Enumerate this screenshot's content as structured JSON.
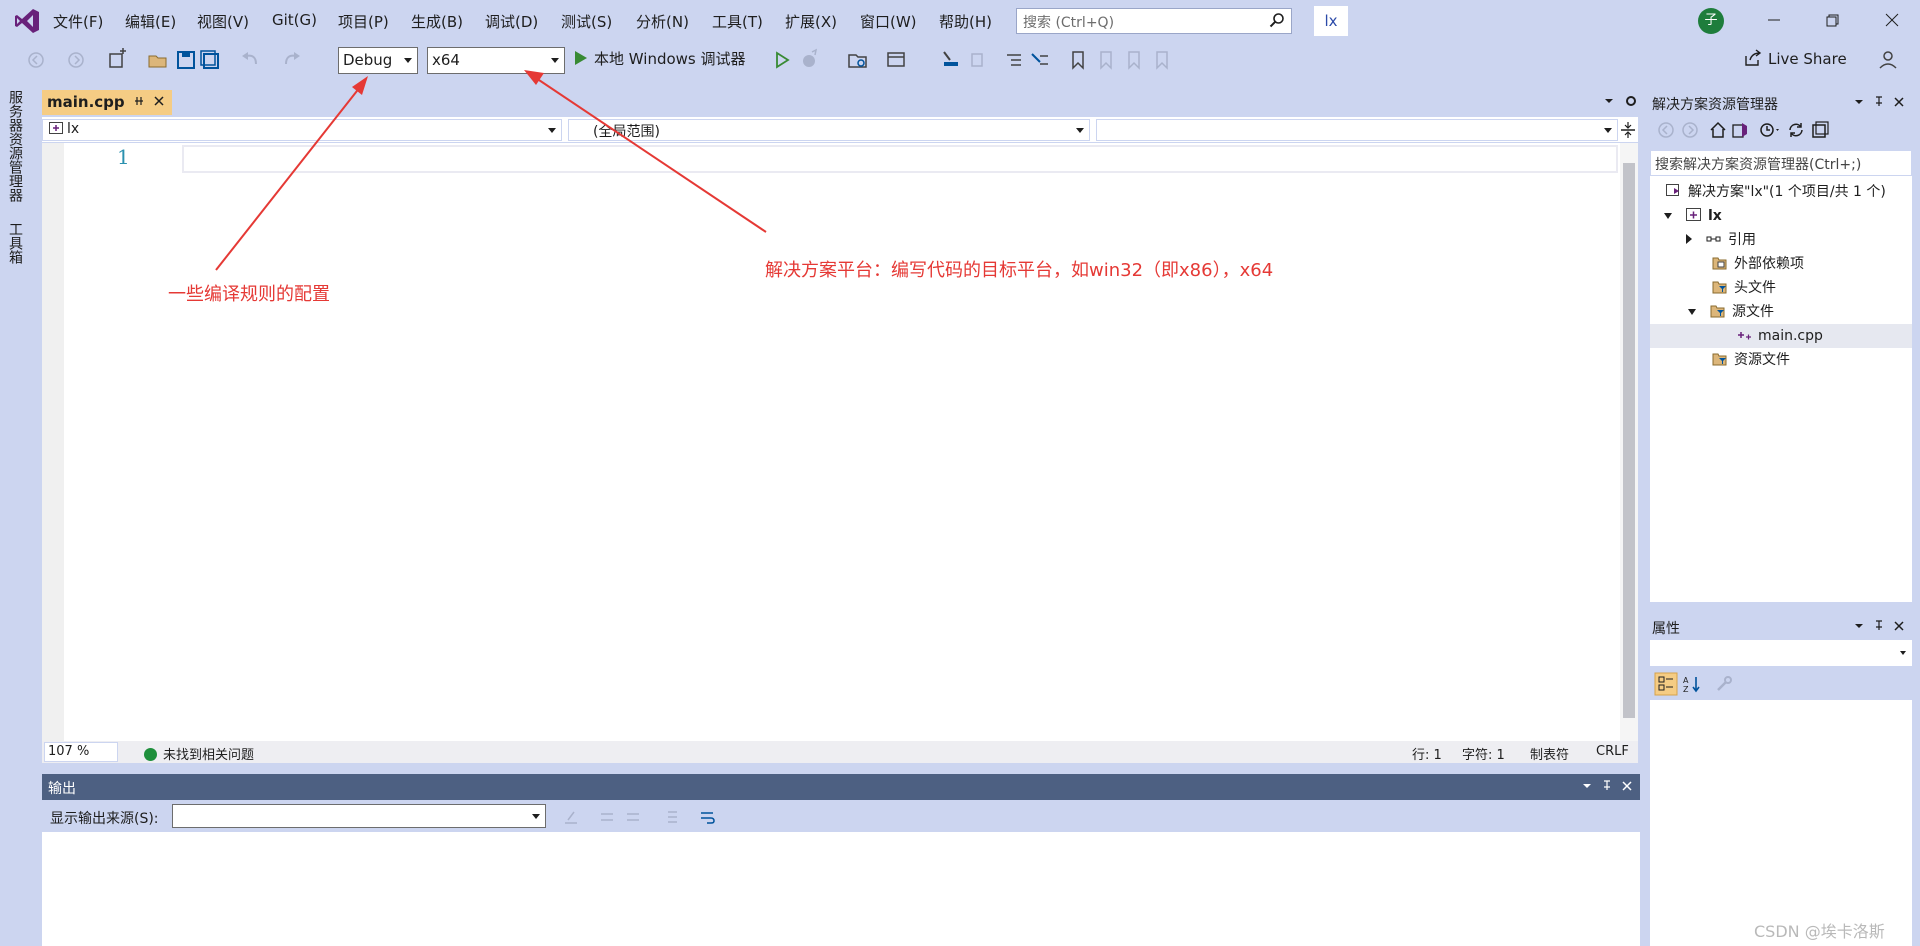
{
  "menubar": {
    "items": [
      "文件(F)",
      "编辑(E)",
      "视图(V)",
      "Git(G)",
      "项目(P)",
      "生成(B)",
      "调试(D)",
      "测试(S)",
      "分析(N)",
      "工具(T)",
      "扩展(X)",
      "窗口(W)",
      "帮助(H)"
    ],
    "search_placeholder": "搜索 (Ctrl+Q)",
    "solution_name": "lx",
    "avatar_initial": "子"
  },
  "toolbar": {
    "configuration": "Debug",
    "platform": "x64",
    "run_label": "本地 Windows 调试器",
    "live_share": "Live Share"
  },
  "left_rail": {
    "server_explorer": "服务器资源管理器",
    "toolbox": "工具箱"
  },
  "document": {
    "tab_name": "main.cpp",
    "nav_project": "lx",
    "nav_scope": "(全局范围)",
    "nav_member": "",
    "line_number": "1",
    "zoom": "107 %",
    "issues": "未找到相关问题",
    "line": "行: 1",
    "column": "字符: 1",
    "tabs": "制表符",
    "line_ending": "CRLF"
  },
  "output": {
    "title": "输出",
    "source_label": "显示输出来源(S):",
    "source_value": ""
  },
  "solution_explorer": {
    "title": "解决方案资源管理器",
    "search_placeholder": "搜索解决方案资源管理器(Ctrl+;)",
    "tree": [
      {
        "label": "解决方案\"lx\"(1 个项目/共 1 个)",
        "icon": "solution-icon"
      },
      {
        "label": "lx",
        "icon": "project-icon"
      },
      {
        "label": "引用",
        "icon": "references-icon"
      },
      {
        "label": "外部依赖项",
        "icon": "external-deps-icon"
      },
      {
        "label": "头文件",
        "icon": "filter-folder-icon"
      },
      {
        "label": "源文件",
        "icon": "filter-folder-icon"
      },
      {
        "label": "main.cpp",
        "icon": "cpp-file-icon"
      },
      {
        "label": "资源文件",
        "icon": "filter-folder-icon"
      }
    ]
  },
  "properties": {
    "title": "属性"
  },
  "annotations": {
    "config_note": "一些编译规则的配置",
    "platform_note": "解决方案平台：编写代码的目标平台，如win32（即x86），x64",
    "arrow_color": "#e53935"
  },
  "watermark": "CSDN @埃卡洛斯",
  "colors": {
    "chrome": "#ccd5f0",
    "active_tab": "#f5cc84",
    "panel_header_dark": "#4d6082",
    "vs_purple": "#68217a"
  }
}
